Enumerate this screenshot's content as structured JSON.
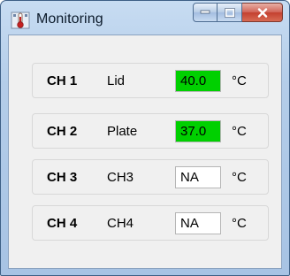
{
  "window": {
    "title": "Monitoring",
    "minimize_label": "—",
    "maximize_label": "□",
    "close_label": "X",
    "app_icon": "thermometer-icon"
  },
  "channels": [
    {
      "ch": "CH 1",
      "name": "Lid",
      "value": "40.0",
      "unit": "°C",
      "active": true
    },
    {
      "ch": "CH 2",
      "name": "Plate",
      "value": "37.0",
      "unit": "°C",
      "active": true
    },
    {
      "ch": "CH 3",
      "name": "CH3",
      "value": "NA",
      "unit": "°C",
      "active": false
    },
    {
      "ch": "CH 4",
      "name": "CH4",
      "value": "NA",
      "unit": "°C",
      "active": false
    }
  ],
  "colors": {
    "active_value_bg": "#00d000",
    "inactive_value_bg": "#ffffff"
  }
}
